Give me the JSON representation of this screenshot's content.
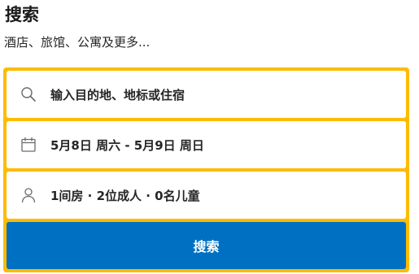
{
  "header": {
    "title": "搜索",
    "subtitle": "酒店、旅馆、公寓及更多..."
  },
  "search_form": {
    "destination": {
      "placeholder": "输入目的地、地标或住宿",
      "icon": "search-icon"
    },
    "dates": {
      "value": "5月8日 周六 - 5月9日 周日",
      "icon": "calendar-icon"
    },
    "guests": {
      "value": "1间房 · 2位成人 · 0名儿童",
      "icon": "person-icon"
    },
    "search_button_label": "搜索"
  },
  "colors": {
    "frame": "#febb02",
    "button": "#0071c2"
  }
}
